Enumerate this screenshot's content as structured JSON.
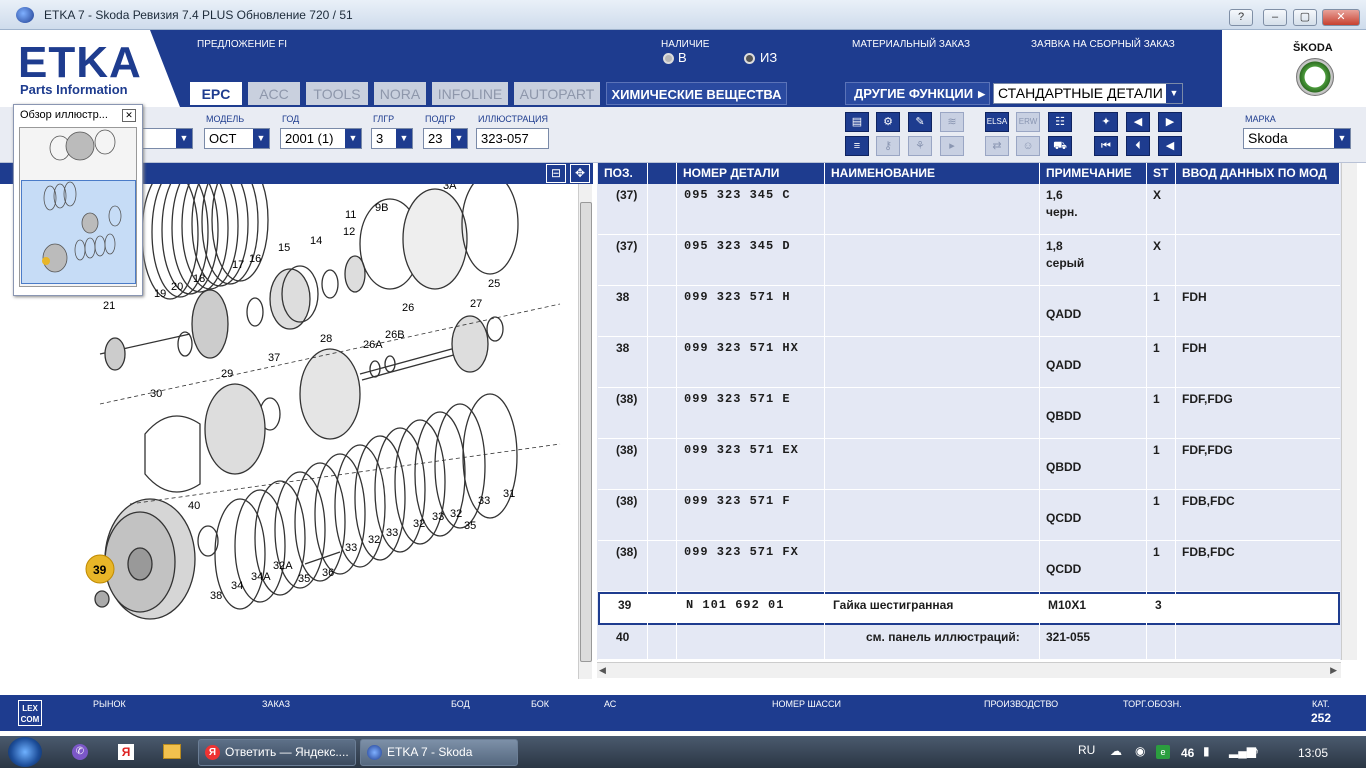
{
  "window": {
    "title": "ETKA 7 - Skoda Ревизия 7.4 PLUS Обновление 720 / 51",
    "help": "?",
    "minimize": "–",
    "maximize": "▢",
    "close": "✕"
  },
  "brand": {
    "logo": "ETKA",
    "subtitle": "Parts Information",
    "make_logo": "ŠKODA"
  },
  "header": {
    "offer_label": "ПРЕДЛОЖЕНИЕ FI",
    "availability_label": "НАЛИЧИЕ",
    "radio_b": "В",
    "radio_iz": "ИЗ",
    "material_order": "МАТЕРИАЛЬНЫЙ ЗАКАЗ",
    "assembly_order": "ЗАЯВКА НА СБОРНЫЙ ЗАКАЗ"
  },
  "tabs": [
    {
      "label": "EPC",
      "active": true
    },
    {
      "label": "ACC"
    },
    {
      "label": "TOOLS"
    },
    {
      "label": "NORA"
    },
    {
      "label": "INFOLINE"
    },
    {
      "label": "AUTOPART"
    },
    {
      "label": "ХИМИЧЕСКИЕ ВЕЩЕСТВА"
    }
  ],
  "other_functions": {
    "label": "ДРУГИЕ ФУНКЦИИ",
    "value": "СТАНДАРТНЫЕ ДЕТАЛИ"
  },
  "filters": {
    "model_label": "МОДЕЛЬ",
    "model": "OCT",
    "year_label": "ГОД",
    "year": "2001 (1)",
    "hg_label": "ГЛГР",
    "hg": "3",
    "sg_label": "ПОДГР",
    "sg": "23",
    "illustration_label": "ИЛЛЮСТРАЦИЯ",
    "illustration": "323-057",
    "make_label": "МАРКА",
    "make": "Skoda"
  },
  "overview": {
    "title": "Обзор иллюстр..."
  },
  "diagram": {
    "labels": [
      "39",
      "40",
      "38",
      "34",
      "34A",
      "32A",
      "35",
      "36",
      "33",
      "32",
      "33",
      "32",
      "33",
      "35",
      "32",
      "33",
      "31",
      "30",
      "29",
      "37",
      "28",
      "26A",
      "26B",
      "26",
      "27",
      "25",
      "21",
      "19",
      "20",
      "18",
      "17",
      "16",
      "15",
      "14",
      "12",
      "11",
      "9B",
      "3A"
    ],
    "callout": "39"
  },
  "table": {
    "headers": {
      "pos": "ПОЗ.",
      "part_no": "НОМЕР ДЕТАЛИ",
      "name": "НАИМЕНОВАНИЕ",
      "note": "ПРИМЕЧАНИЕ",
      "st": "ST",
      "model_data": "ВВОД ДАННЫХ ПО МОД"
    },
    "rows": [
      {
        "pos": "(37)",
        "part_no": "095 323 345 C",
        "name": "",
        "note1": "1,6",
        "note2": "черн.",
        "st": "X",
        "model": ""
      },
      {
        "pos": "(37)",
        "part_no": "095 323 345 D",
        "name": "",
        "note1": "1,8",
        "note2": "серый",
        "st": "X",
        "model": ""
      },
      {
        "pos": "38",
        "part_no": "099 323 571 H",
        "name": "",
        "note1": "",
        "note2": "QADD",
        "st": "1",
        "model": "FDH"
      },
      {
        "pos": "38",
        "part_no": "099 323 571 HX",
        "name": "",
        "note1": "",
        "note2": "QADD",
        "st": "1",
        "model": "FDH"
      },
      {
        "pos": "(38)",
        "part_no": "099 323 571 E",
        "name": "",
        "note1": "",
        "note2": "QBDD",
        "st": "1",
        "model": "FDF,FDG"
      },
      {
        "pos": "(38)",
        "part_no": "099 323 571 EX",
        "name": "",
        "note1": "",
        "note2": "QBDD",
        "st": "1",
        "model": "FDF,FDG"
      },
      {
        "pos": "(38)",
        "part_no": "099 323 571 F",
        "name": "",
        "note1": "",
        "note2": "QCDD",
        "st": "1",
        "model": "FDB,FDC"
      },
      {
        "pos": "(38)",
        "part_no": "099 323 571 FX",
        "name": "",
        "note1": "",
        "note2": "QCDD",
        "st": "1",
        "model": "FDB,FDC"
      },
      {
        "pos": "39",
        "part_no": "N   101 692 01",
        "name": "Гайка шестигранная",
        "note1": "M10X1",
        "note2": "",
        "st": "3",
        "model": ""
      }
    ],
    "last_row": {
      "pos": "40",
      "see_label": "см. панель иллюстраций:",
      "ref": "321-055"
    }
  },
  "status": {
    "lexcom": "LEX COM",
    "market": "РЫНОК",
    "order": "ЗАКАЗ",
    "bod": "БОД",
    "bok": "БОК",
    "ac": "АС",
    "chassis": "НОМЕР ШАССИ",
    "production": "ПРОИЗВОДСТВО",
    "trade": "ТОРГ.ОБОЗН.",
    "cat_label": "КАТ.",
    "cat_value": "252"
  },
  "taskbar": {
    "task1": "Ответить — Яндекс....",
    "task2": "ETKA 7 - Skoda",
    "lang": "RU",
    "badge": "46",
    "time": "13:05"
  },
  "colors": {
    "brand_blue": "#1e3c8f",
    "table_bg": "#e4e8f4",
    "callout": "#e8b628"
  }
}
